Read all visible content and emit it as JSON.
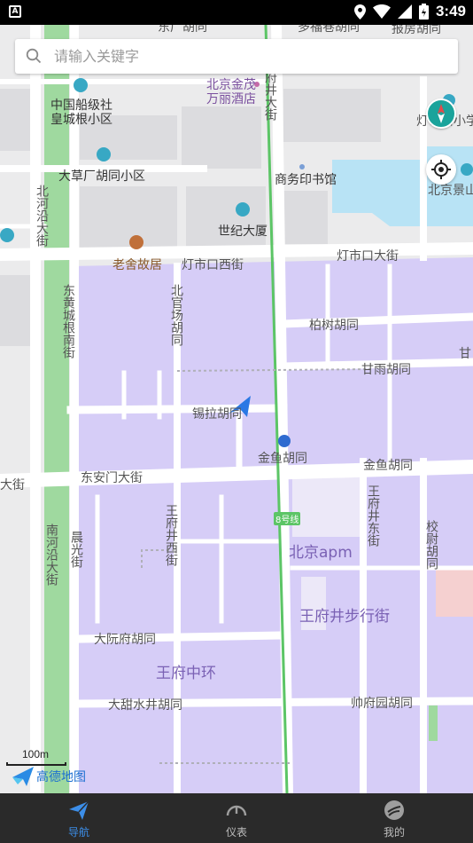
{
  "status_bar": {
    "time": "3:49",
    "notification_glyph": "A"
  },
  "search": {
    "placeholder": "请输入关键字",
    "value": ""
  },
  "map": {
    "labels": {
      "top_hutong_left": "东厂胡同",
      "top_hutong_right": "报房胡同",
      "top_hutong_mid": "多福巷胡同",
      "chuanbo": "中国船级社",
      "huangcheng": "皇城根小区",
      "jinmao1": "北京金茂",
      "jinmao2": "万丽酒店",
      "fujing": "府井大街",
      "dengshi_school": "灯市口小学",
      "dacao": "大草厂胡同小区",
      "shangwu": "商务印书馆",
      "jingshan": "北京景山",
      "beiheyan": "北河沿大街",
      "shiji": "世纪大厦",
      "laoshe": "老舍故居",
      "dengshikou_west": "灯市口西街",
      "dengshikou_st": "灯市口大街",
      "donghuang": "东黄城根南街",
      "beiguan": "北官场胡同",
      "baishu": "柏树胡同",
      "ganyu": "甘雨胡同",
      "ganshi": "甘",
      "xila": "锡拉胡同",
      "jinyu_small": "金鱼胡同",
      "jinyu": "金鱼胡同",
      "dajie_left": "大街",
      "donganmen": "东安门大街",
      "wangfujing_xi": "王府井西街",
      "wangfujing_dong": "王府井东街",
      "xiaowei": "校尉胡同",
      "nanheyan": "南河沿大街",
      "chenguang": "晨光街",
      "line8": "8号线",
      "apm": "北京apm",
      "walkstreet": "王府井步行街",
      "dayuanfu": "大阮府胡同",
      "zhonghuan": "王府中环",
      "datianshuijing": "大甜水井胡同",
      "shuaifuyuan": "帅府园胡同"
    },
    "scale_text": "100m",
    "logo_text": "高德地图",
    "colors": {
      "area": "#d6cdf7",
      "metro_line": "#5cc566",
      "park": "#9fd99f",
      "water": "#b8e3f5",
      "road": "#ffffff"
    }
  },
  "bottom_nav": [
    {
      "label": "导航",
      "icon": "navigation-icon",
      "active": true
    },
    {
      "label": "仪表",
      "icon": "speedometer-icon",
      "active": false
    },
    {
      "label": "我的",
      "icon": "profile-icon",
      "active": false
    }
  ]
}
